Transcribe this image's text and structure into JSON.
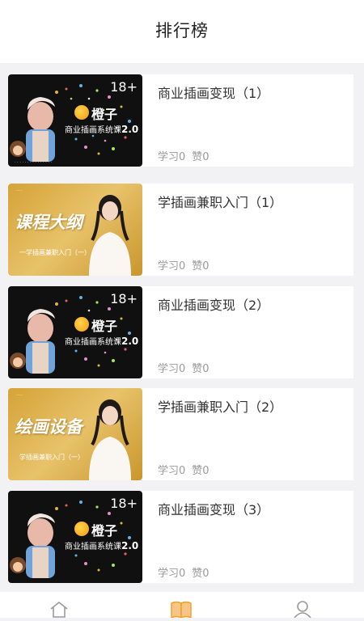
{
  "header": {
    "title": "排行榜"
  },
  "courses": [
    {
      "title": "商业插画变现（1）",
      "thumb": {
        "style": "dark",
        "badge": "18+",
        "logo": "橙子",
        "course": "商业插画系统课",
        "version": "2.0"
      },
      "stats": {
        "study": "学习0",
        "like": "赞0"
      }
    },
    {
      "title": "学插画兼职入门（1）",
      "thumb": {
        "style": "gold",
        "headline": "课程大纲",
        "sub": "一学插画兼职入门（一）"
      },
      "stats": {
        "study": "学习0",
        "like": "赞0"
      }
    },
    {
      "title": "商业插画变现（2）",
      "thumb": {
        "style": "dark",
        "badge": "18+",
        "logo": "橙子",
        "course": "商业插画系统课",
        "version": "2.0"
      },
      "stats": {
        "study": "学习0",
        "like": "赞0"
      }
    },
    {
      "title": "学插画兼职入门（2）",
      "thumb": {
        "style": "gold",
        "headline": "绘画设备",
        "sub": "学插画兼职入门（一）"
      },
      "stats": {
        "study": "学习0",
        "like": "赞0"
      }
    },
    {
      "title": "商业插画变现（3）",
      "thumb": {
        "style": "dark",
        "badge": "18+",
        "logo": "橙子",
        "course": "商业插画系统课",
        "version": "2.0"
      },
      "stats": {
        "study": "学习0",
        "like": "赞0"
      }
    }
  ],
  "bottom_nav": [
    {
      "icon": "home-icon"
    },
    {
      "icon": "book-icon",
      "active": true
    },
    {
      "icon": "user-icon"
    }
  ],
  "colors": {
    "accent": "#f0a020",
    "text": "#333333",
    "muted": "#9a9a9a",
    "background": "#f2f2f4"
  }
}
